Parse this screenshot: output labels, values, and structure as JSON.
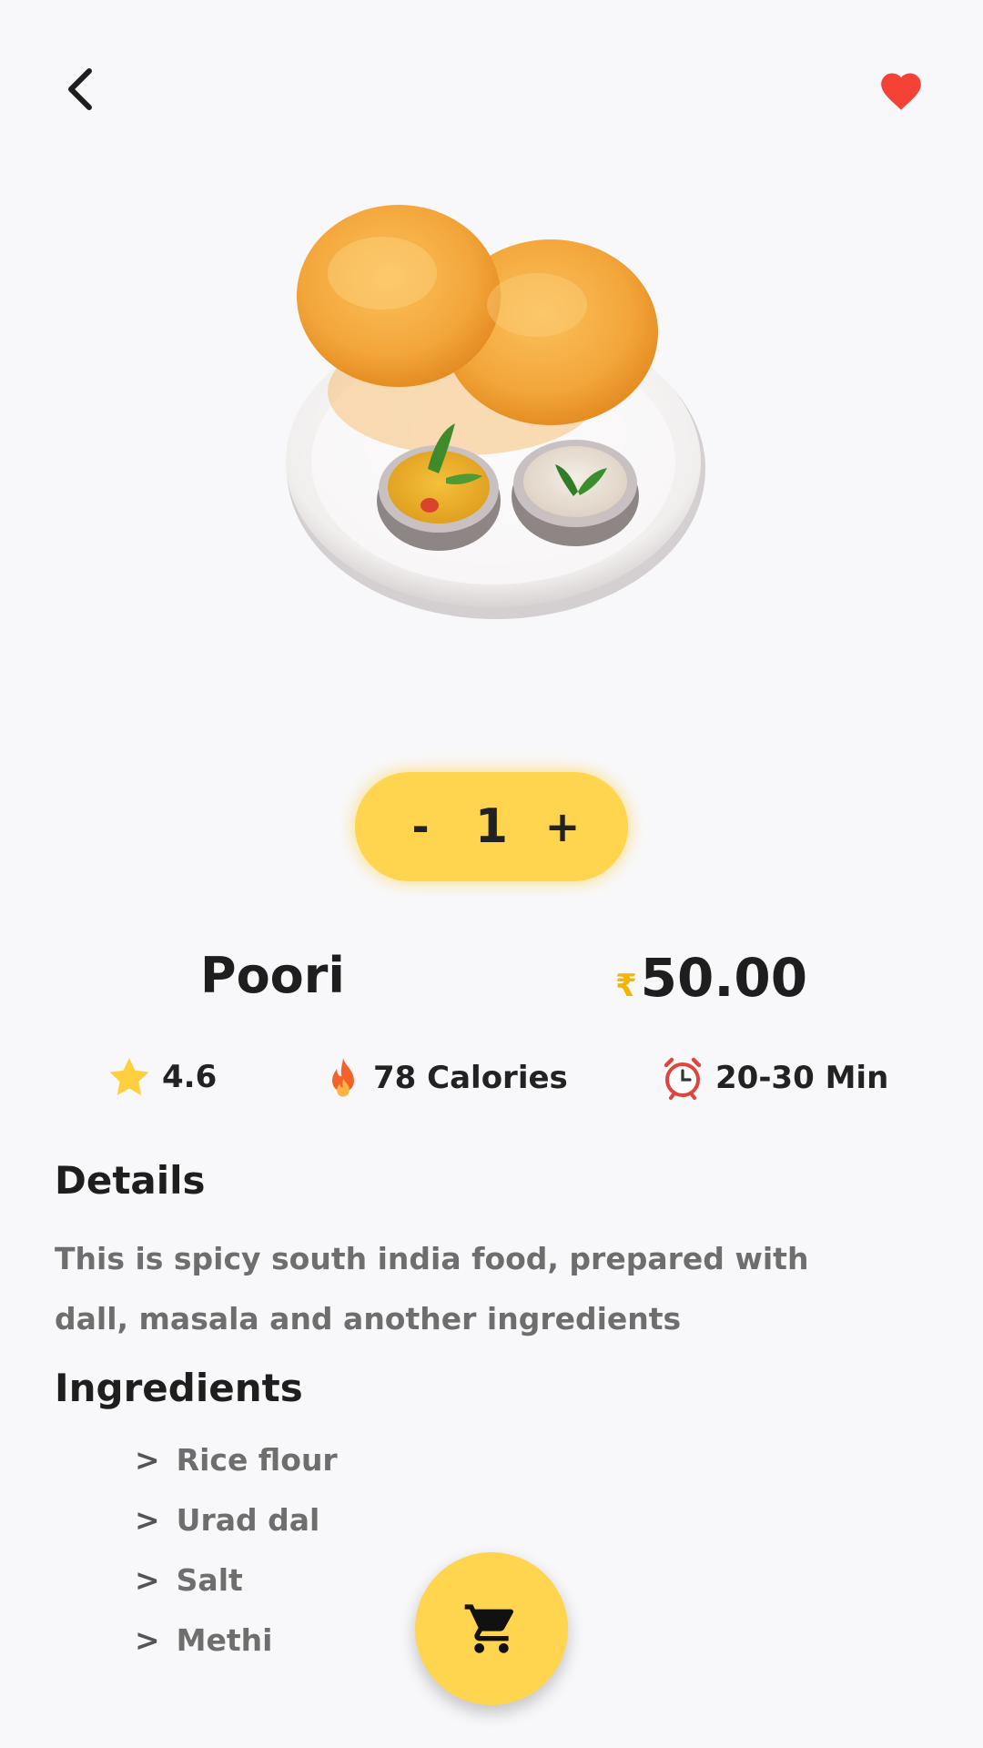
{
  "header": {
    "back_icon": "chevron-left-icon",
    "favorite_icon": "heart-icon",
    "favorite_color": "#f44336"
  },
  "product": {
    "name": "Poori",
    "currency_symbol": "₹",
    "price": "50.00",
    "quantity": "1",
    "decrement_label": "-",
    "increment_label": "+",
    "image": "poori-plate-image"
  },
  "info": {
    "rating": "4.6",
    "calories": "78 Calories",
    "time": "20-30 Min"
  },
  "details": {
    "title": "Details",
    "text": "This is spicy south india food, prepared with dall, masala and another ingredients"
  },
  "ingredients": {
    "title": "Ingredients",
    "marker": ">",
    "items": [
      "Rice flour",
      "Urad dal",
      "Salt",
      "Methi"
    ]
  },
  "colors": {
    "accent": "#ffd54f",
    "background": "#f8f8fa",
    "text_muted": "#6e6e6e"
  },
  "cart": {
    "icon": "cart-icon"
  }
}
